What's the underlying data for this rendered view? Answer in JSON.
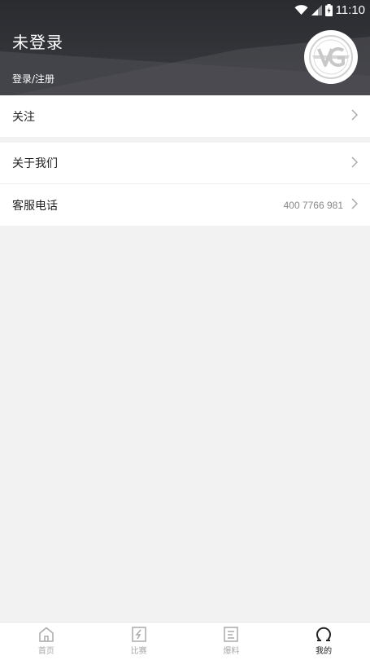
{
  "status_bar": {
    "time": "11:10"
  },
  "header": {
    "title": "未登录",
    "login_link": "登录/注册"
  },
  "menu": {
    "follow": {
      "label": "关注"
    },
    "about": {
      "label": "关于我们"
    },
    "service": {
      "label": "客服电话",
      "phone": "400 7766 981"
    }
  },
  "tabbar": {
    "tabs": [
      {
        "label": "首页",
        "icon": "home-icon"
      },
      {
        "label": "比赛",
        "icon": "match-icon"
      },
      {
        "label": "爆料",
        "icon": "news-icon"
      },
      {
        "label": "我的",
        "icon": "profile-icon"
      }
    ],
    "active": "我的"
  },
  "colors": {
    "header": "#2e2f33",
    "background": "#f2f2f2",
    "active_tab": "#222222",
    "inactive_tab": "#aaaaaa"
  }
}
